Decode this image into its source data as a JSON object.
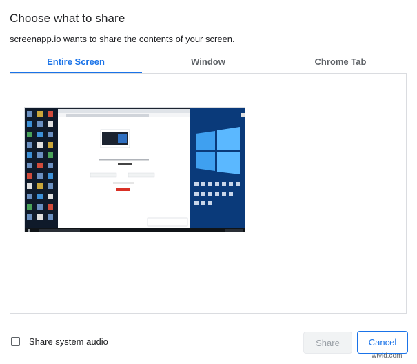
{
  "dialog": {
    "title": "Choose what to share",
    "subtitle": "screenapp.io wants to share the contents of your screen."
  },
  "tabs": [
    {
      "label": "Entire Screen",
      "active": true
    },
    {
      "label": "Window",
      "active": false
    },
    {
      "label": "Chrome Tab",
      "active": false
    }
  ],
  "audio": {
    "label": "Share system audio",
    "checked": false
  },
  "buttons": {
    "share_label": "Share",
    "cancel_label": "Cancel"
  },
  "watermark": "wtvid.com",
  "colors": {
    "accent": "#1a73e8",
    "disabled_bg": "#f1f3f4",
    "disabled_text": "#9aa0a6",
    "border": "#dadce0"
  }
}
